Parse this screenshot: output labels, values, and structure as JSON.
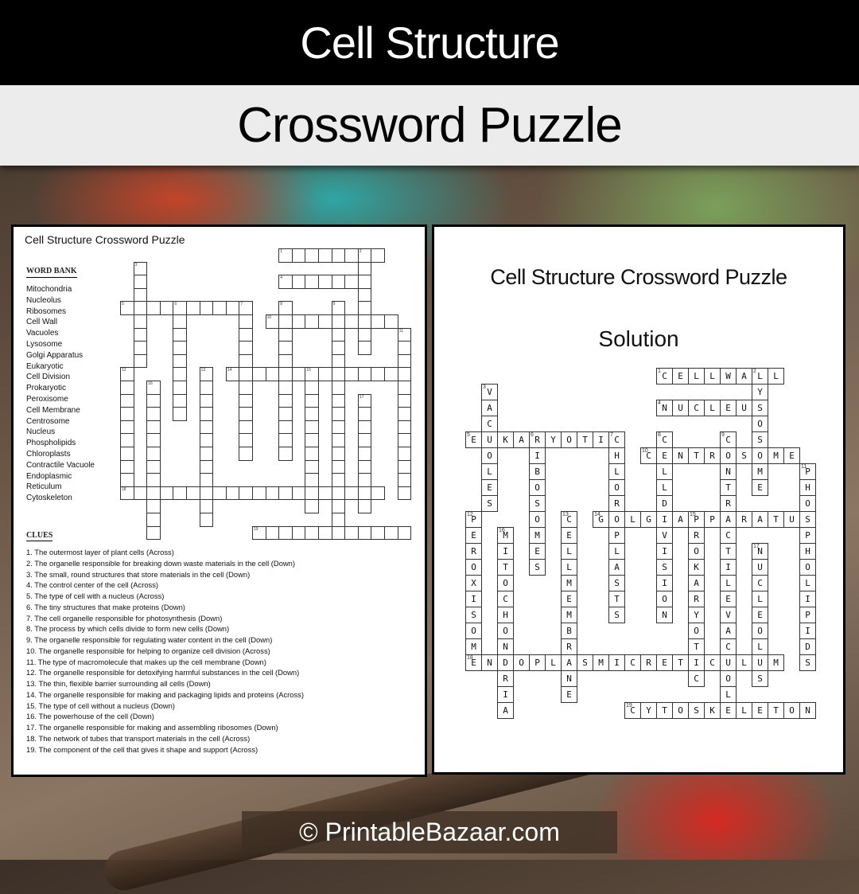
{
  "banner": {
    "title": "Cell Structure",
    "subtitle": "Crossword Puzzle"
  },
  "puzzle": {
    "title": "Cell Structure Crossword Puzzle",
    "word_bank_heading": "WORD BANK",
    "word_bank": [
      "Mitochondria",
      "Nucleolus",
      "Ribosomes",
      "Cell Wall",
      "Vacuoles",
      "Lysosome",
      "Golgi Apparatus",
      "Eukaryotic",
      "Cell Division",
      "Prokaryotic",
      "Peroxisome",
      "Cell Membrane",
      "Centrosome",
      "Nucleus",
      "Phospholipids",
      "Chloroplasts",
      "Contractile Vacuole",
      "Endoplasmic",
      "Reticulum",
      "Cytoskeleton"
    ],
    "clues_heading": "CLUES",
    "clues": [
      "1. The outermost  layer of plant cells (Across)",
      "2. The organelle responsible for breaking down  waste materials in the cell (Down)",
      "3. The small, round structures that store materials in the cell (Down)",
      "4. The control center of the cell (Across)",
      "5. The type of cell with a nucleus (Across)",
      "6. The tiny structures that make proteins (Down)",
      "7. The cell organelle responsible for photosynthesis (Down)",
      "8. The process by which cells divide to  form  new cells (Down)",
      "9. The organelle responsible for regulating water content  in the cell (Down)",
      "10. The organelle responsible for helping to organize cell division (Across)",
      "11. The type of macromolecule  that makes up the cell membrane  (Down)",
      "12. The organelle responsible for detoxifying harmful  substances in the cell (Down)",
      "13. The thin, flexible barrier surrounding  all cells (Down)",
      "14. The organelle responsible for making and packaging lipids and proteins  (Across)",
      "15. The type of cell without  a nucleus (Down)",
      "16. The powerhouse  of the cell (Down)",
      "17. The organelle responsible for making and assembling ribosomes (Down)",
      "18. The network  of tubes that transport materials in the cell (Across)",
      "19. The component  of the cell that gives it shape and support (Across)"
    ]
  },
  "solution": {
    "title": "Cell Structure Crossword Puzzle",
    "subtitle": "Solution"
  },
  "crossword": {
    "entries": [
      {
        "num": 1,
        "dir": "across",
        "row": 0,
        "col": 12,
        "answer": "CELLWALL"
      },
      {
        "num": 2,
        "dir": "down",
        "row": 0,
        "col": 18,
        "answer": "LYSOSOME"
      },
      {
        "num": 3,
        "dir": "down",
        "row": 1,
        "col": 1,
        "answer": "VACUOLES"
      },
      {
        "num": 4,
        "dir": "across",
        "row": 2,
        "col": 12,
        "answer": "NUCLEUS"
      },
      {
        "num": 5,
        "dir": "across",
        "row": 4,
        "col": 0,
        "answer": "EUKARYOTIC"
      },
      {
        "num": 6,
        "dir": "down",
        "row": 4,
        "col": 4,
        "answer": "RIBOSOMES"
      },
      {
        "num": 7,
        "dir": "down",
        "row": 4,
        "col": 9,
        "answer": "CHLOROPLASTS"
      },
      {
        "num": 8,
        "dir": "down",
        "row": 4,
        "col": 12,
        "answer": "CELLDIVISION"
      },
      {
        "num": 9,
        "dir": "down",
        "row": 4,
        "col": 16,
        "answer": "CONTRACTILEVACUOL"
      },
      {
        "num": 10,
        "dir": "across",
        "row": 5,
        "col": 11,
        "answer": "CENTROSOME"
      },
      {
        "num": 11,
        "dir": "down",
        "row": 6,
        "col": 21,
        "answer": "PHOSPHOLIPIDS"
      },
      {
        "num": 12,
        "dir": "down",
        "row": 9,
        "col": 0,
        "answer": "PEROXISOME"
      },
      {
        "num": 13,
        "dir": "down",
        "row": 9,
        "col": 6,
        "answer": "CELLMEMBRANE"
      },
      {
        "num": 14,
        "dir": "across",
        "row": 9,
        "col": 8,
        "answer": "GOLGIAPPARATUS"
      },
      {
        "num": 15,
        "dir": "down",
        "row": 9,
        "col": 14,
        "answer": "PROKARYOTIC"
      },
      {
        "num": 16,
        "dir": "down",
        "row": 10,
        "col": 2,
        "answer": "MITOCHONDRIA"
      },
      {
        "num": 17,
        "dir": "down",
        "row": 11,
        "col": 18,
        "answer": "NUCLEOLUS"
      },
      {
        "num": 18,
        "dir": "across",
        "row": 18,
        "col": 0,
        "answer": "ENDOPLASMICRETICULUM"
      },
      {
        "num": 19,
        "dir": "across",
        "row": 21,
        "col": 10,
        "answer": "CYTOSKELETON"
      }
    ]
  },
  "footer": {
    "text": "© PrintableBazaar.com"
  }
}
